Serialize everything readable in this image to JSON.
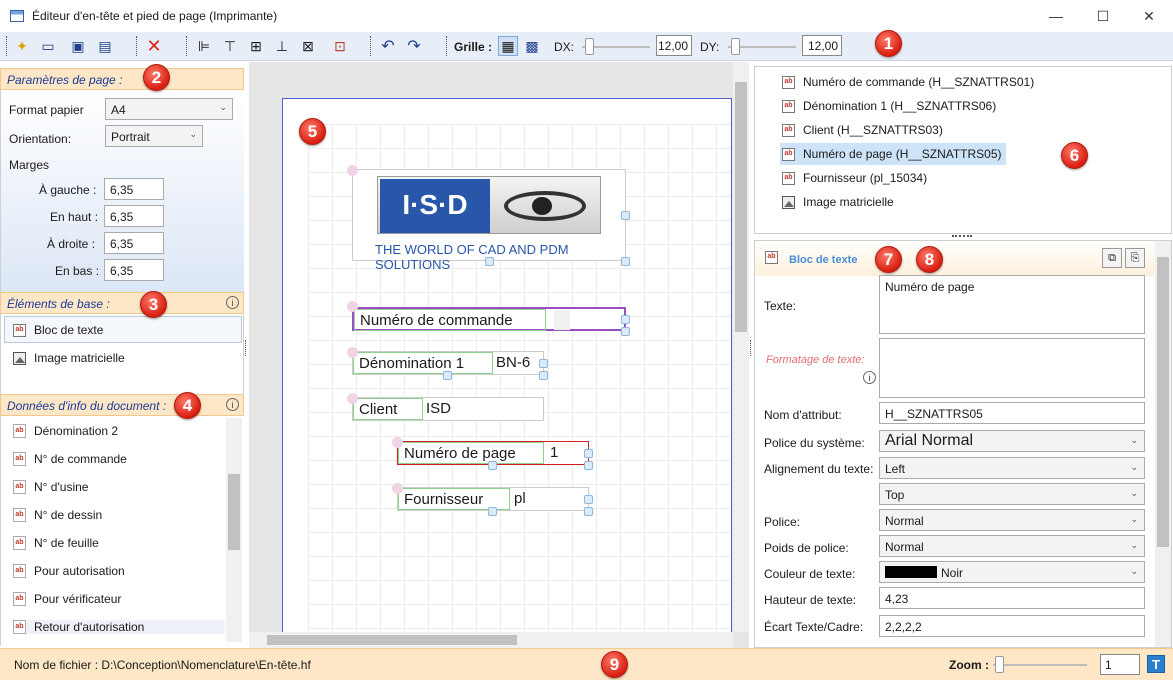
{
  "window": {
    "title": "Éditeur d'en-tête et pied de page (Imprimante)",
    "minimize": "—",
    "maximize": "☐",
    "close": "✕"
  },
  "toolbar": {
    "grid_label": "Grille :",
    "dx_label": "DX:",
    "dx_value": "12,00",
    "dx_level": 0.05,
    "dy_label": "DY:",
    "dy_value": "12,00",
    "dy_level": 0.05
  },
  "badges": [
    "1",
    "2",
    "3",
    "4",
    "5",
    "6",
    "7",
    "8",
    "9"
  ],
  "left": {
    "page_params": {
      "header": "Paramètres de page :",
      "paper_label": "Format papier",
      "paper_value": "A4",
      "orientation_label": "Orientation:",
      "orientation_value": "Portrait",
      "margins_label": "Marges",
      "left_label": "À gauche :",
      "left_value": "6,35",
      "top_label": "En haut :",
      "top_value": "6,35",
      "right_label": "À droite :",
      "right_value": "6,35",
      "bottom_label": "En bas :",
      "bottom_value": "6,35"
    },
    "base_elements": {
      "header": "Éléments de base :",
      "items": [
        "Bloc de texte",
        "Image matricielle"
      ]
    },
    "doc_info": {
      "header": "Données d'info du document :",
      "items": [
        "Dénomination 2",
        "N° de commande",
        "N° d'usine",
        "N° de dessin",
        "N° de feuille",
        "Pour autorisation",
        "Pour vérificateur",
        "Retour d'autorisation"
      ]
    }
  },
  "canvas": {
    "logo_text": "I·S·D",
    "logo_tagline": "THE WORLD OF CAD AND PDM SOLUTIONS",
    "blocks": [
      {
        "label": "Numéro de commande",
        "value": ""
      },
      {
        "label": "Dénomination 1",
        "value": "BN-6"
      },
      {
        "label": "Client",
        "value": "ISD"
      },
      {
        "label": "Numéro de page",
        "value": "1"
      },
      {
        "label": "Fournisseur",
        "value": "pl"
      }
    ]
  },
  "attributes": [
    "Numéro de commande (H__SZNATTRS01)",
    "Dénomination 1 (H__SZNATTRS06)",
    "Client (H__SZNATTRS03)",
    "Numéro de page (H__SZNATTRS05)",
    "Fournisseur (pl_15034)",
    "Image matricielle"
  ],
  "props": {
    "header": "Bloc de texte",
    "text_label": "Texte:",
    "text_value": "Numéro de page",
    "format_label": "Formatage de texte:",
    "attr_label": "Nom d'attribut:",
    "attr_value": "H__SZNATTRS05",
    "sysfont_label": "Police du système:",
    "sysfont_value": "Arial Normal",
    "align_label": "Alignement du texte:",
    "align_h": "Left",
    "align_v": "Top",
    "font_label": "Police:",
    "font_value": "Normal",
    "weight_label": "Poids de police:",
    "weight_value": "Normal",
    "color_label": "Couleur de texte:",
    "color_value": "Noir",
    "color_hex": "#000000",
    "height_label": "Hauteur de texte:",
    "height_value": "4,23",
    "gap_label": "Écart Texte/Cadre:",
    "gap_value": "2,2,2,2"
  },
  "status": {
    "file_label": "Nom de fichier : D:\\Conception\\Nomenclature\\En-tête.hf",
    "zoom_label": "Zoom :",
    "zoom_value": "1",
    "zoom_level": 0.02,
    "t_button": "T"
  }
}
